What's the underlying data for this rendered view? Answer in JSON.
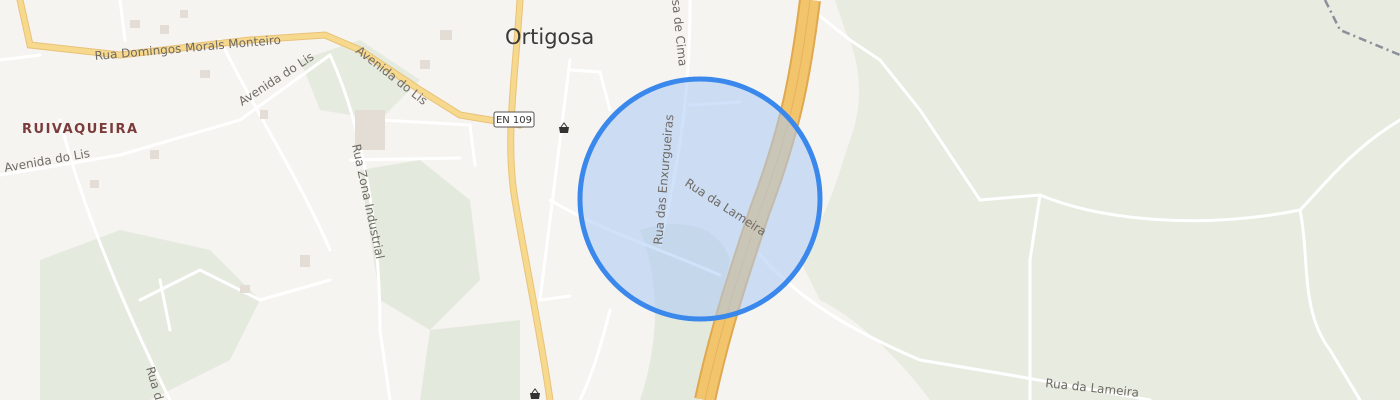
{
  "map": {
    "places": {
      "town": "Ortigosa",
      "suburb": "RUIVAQUEIRA"
    },
    "route_shield": "EN 109",
    "roads": [
      "Rua Domingos Morals Monteiro",
      "Avenida do Lis",
      "Avenida do Lis",
      "Avenida do Lis",
      "Rua Zona Industrial",
      "Rua das Enxurgueiras",
      "Rua da Lameira",
      "Rua da Lameira",
      "Rua de",
      "sa de Cima"
    ],
    "colors": {
      "background": "#f6f4f0",
      "forest": "#e7ebe0",
      "motorway": "#f2c46b",
      "trunk_road": "#f7d98e",
      "selection_fill": "#aac8f5",
      "selection_stroke": "#3b88ec",
      "boundary": "#8a8f9a"
    },
    "icons": [
      "shop-basket-icon",
      "shop-basket-icon"
    ]
  }
}
